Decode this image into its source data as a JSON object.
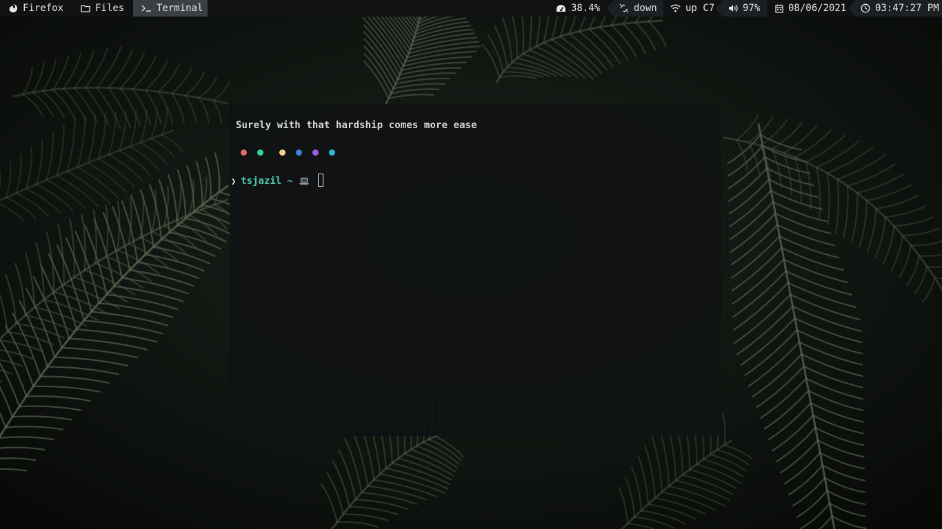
{
  "workspaces": [
    {
      "label": "Firefox",
      "icon": "firefox-icon"
    },
    {
      "label": "Files",
      "icon": "folder-icon"
    },
    {
      "label": "Terminal",
      "icon": "terminal-icon",
      "active": true
    }
  ],
  "status": {
    "cpu": {
      "icon": "gauge-icon",
      "value": "38.4%"
    },
    "ethernet": {
      "icon": "unlink-icon",
      "value": "down"
    },
    "wifi": {
      "icon": "wifi-icon",
      "value": "up C7"
    },
    "volume": {
      "icon": "volume-icon",
      "value": "97%"
    },
    "date": {
      "icon": "calendar-icon",
      "value": "08/06/2021"
    },
    "time": {
      "icon": "clock-icon",
      "value": "03:47:27 PM"
    }
  },
  "terminal": {
    "quote": "Surely with that hardship comes more ease",
    "palette": [
      "#e06c6c",
      "#2ed3a0",
      "#f3cf8f",
      "#3f84d8",
      "#9b5ee8",
      "#2fb7d8"
    ],
    "prompt": {
      "arrow": "❯",
      "user": "tsjazil",
      "path": "~",
      "icon": "laptop-icon"
    }
  },
  "colors": {
    "bar_bg": "#0f1112",
    "active_ws": "#3b3f42",
    "terminal_bg": "#101213",
    "prompt_accent": "#4fc9a9"
  }
}
